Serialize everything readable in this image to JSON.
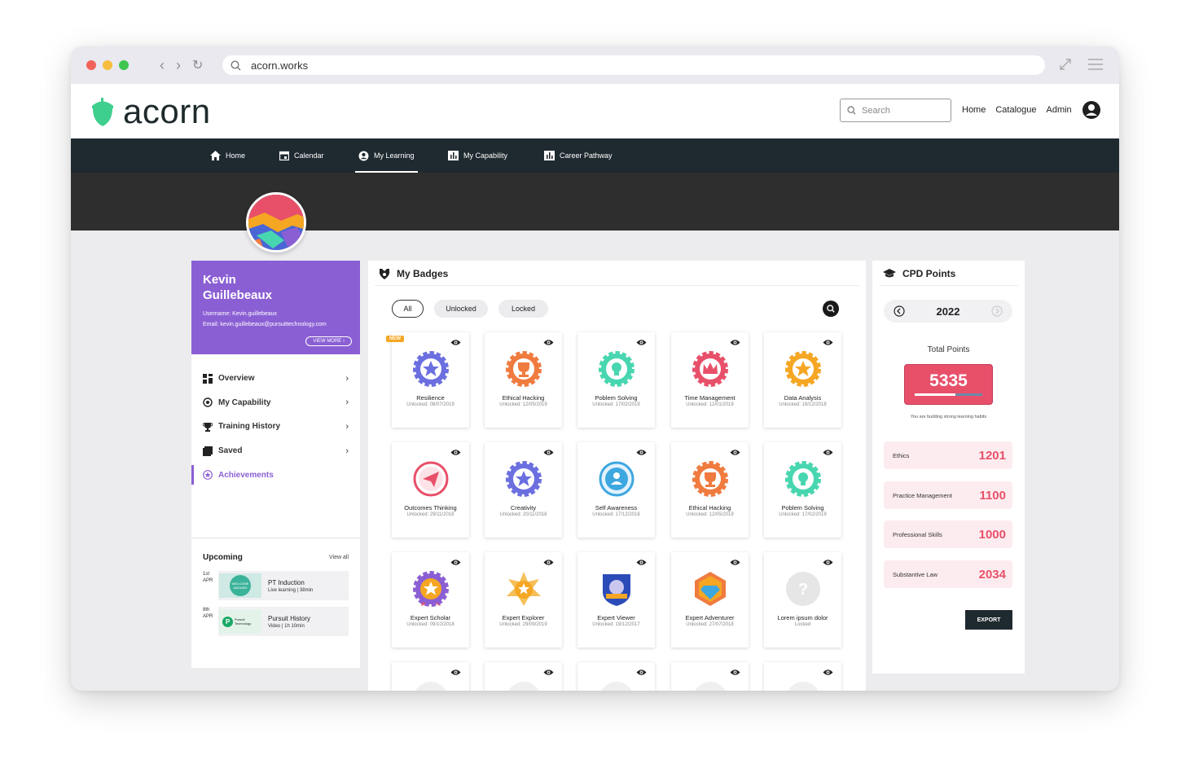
{
  "browser": {
    "url": "acorn.works"
  },
  "header": {
    "logo_text": "acorn",
    "search_placeholder": "Search",
    "links": [
      "Home",
      "Catalogue",
      "Admin"
    ]
  },
  "nav": {
    "items": [
      {
        "label": "Home",
        "icon": "home-icon"
      },
      {
        "label": "Calendar",
        "icon": "calendar-icon"
      },
      {
        "label": "My Learning",
        "icon": "user-circle-icon",
        "active": true
      },
      {
        "label": "My Capability",
        "icon": "bar-chart-icon"
      },
      {
        "label": "Career Pathway",
        "icon": "bar-chart-icon"
      }
    ]
  },
  "profile": {
    "name_first": "Kevin",
    "name_last": "Guillebeaux",
    "username": "Username: Kevin.guillebeaux",
    "email": "Email: kevin.guillebeaux@pursuittechnology.com",
    "view_more": "VIEW MORE"
  },
  "sidemenu": {
    "items": [
      {
        "label": "Overview",
        "icon": "grid-icon"
      },
      {
        "label": "My Capability",
        "icon": "target-icon"
      },
      {
        "label": "Training History",
        "icon": "trophy-icon"
      },
      {
        "label": "Saved",
        "icon": "bookmark-icon"
      },
      {
        "label": "Achievements",
        "icon": "star-circle-icon",
        "active": true
      }
    ]
  },
  "upcoming": {
    "title": "Upcoming",
    "view_all": "View all",
    "items": [
      {
        "day": "1st",
        "month": "APR",
        "title": "PT Induction",
        "meta": "Live learning  |  38min",
        "thumb": "WELCOME ABOARD"
      },
      {
        "day": "8th",
        "month": "APR",
        "title": "Pursuit History",
        "meta": "Video  |  1h 10min",
        "thumb": "Pursuit Technology"
      }
    ]
  },
  "badges": {
    "title": "My Badges",
    "filters": [
      "All",
      "Unlocked",
      "Locked"
    ],
    "new_label": "NEW",
    "items": [
      {
        "name": "Resilience",
        "date": "Unlocked: 08/07/2019",
        "art": "star",
        "color": "#6b6fe0",
        "new": true
      },
      {
        "name": "Ethical Hacking",
        "date": "Unlocked: 12/05/2019",
        "art": "trophy",
        "color": "#f07b3f"
      },
      {
        "name": "Poblem Solving",
        "date": "Unlocked: 17/02/2019",
        "art": "bulb",
        "color": "#48d6b0"
      },
      {
        "name": "Time Management",
        "date": "Unlocked: 12/01/2019",
        "art": "crown",
        "color": "#e8506a"
      },
      {
        "name": "Data Analysis",
        "date": "Unlocked: 19/12/2018",
        "art": "star",
        "color": "#f5a623"
      },
      {
        "name": "Outcomes Thinking",
        "date": "Unlocked: 29/11/2018",
        "art": "plane",
        "color": "#e8506a"
      },
      {
        "name": "Creativity",
        "date": "Unlocked: 20/11/2018",
        "art": "star",
        "color": "#6b6fe0"
      },
      {
        "name": "Self Awareness",
        "date": "Unlocked: 17/12/2018",
        "art": "person",
        "color": "#3da7e0"
      },
      {
        "name": "Ethical Hacking",
        "date": "Unlocked: 12/05/2019",
        "art": "trophy",
        "color": "#f07b3f"
      },
      {
        "name": "Poblem Solving",
        "date": "Unlocked: 17/02/2019",
        "art": "bulb",
        "color": "#48d6b0"
      },
      {
        "name": "Expert Scholar",
        "date": "Unlocked: 09/10/2018",
        "art": "rosette",
        "color": "#8b5fd4"
      },
      {
        "name": "Expert Explorer",
        "date": "Unlocked: 29/09/2019",
        "art": "starburst",
        "color": "#f5a623"
      },
      {
        "name": "Expert Viewer",
        "date": "Unlocked: 19/12/2017",
        "art": "shield",
        "color": "#2b4cb8"
      },
      {
        "name": "Expert Adventurer",
        "date": "Unlocked: 27/07/2018",
        "art": "gem",
        "color": "#f07b3f"
      },
      {
        "name": "Lorem ipsum dolor",
        "date": "Locked",
        "art": "locked",
        "color": "#e6e6e6"
      }
    ]
  },
  "cpd": {
    "title": "CPD Points",
    "year": "2022",
    "total_label": "Total Points",
    "total": "5335",
    "progress": 0.6,
    "note": "You are building strong learning habits",
    "categories": [
      {
        "name": "Ethics",
        "value": "1201"
      },
      {
        "name": "Practice Management",
        "value": "1100"
      },
      {
        "name": "Professional Skills",
        "value": "1000"
      },
      {
        "name": "Substantive Law",
        "value": "2034"
      }
    ],
    "export": "EXPORT"
  },
  "colors": {
    "accent": "#8b5fd4",
    "brand_green": "#3ecf8e",
    "cpd_red": "#e8506a",
    "nav_bg": "#1f2a30"
  }
}
